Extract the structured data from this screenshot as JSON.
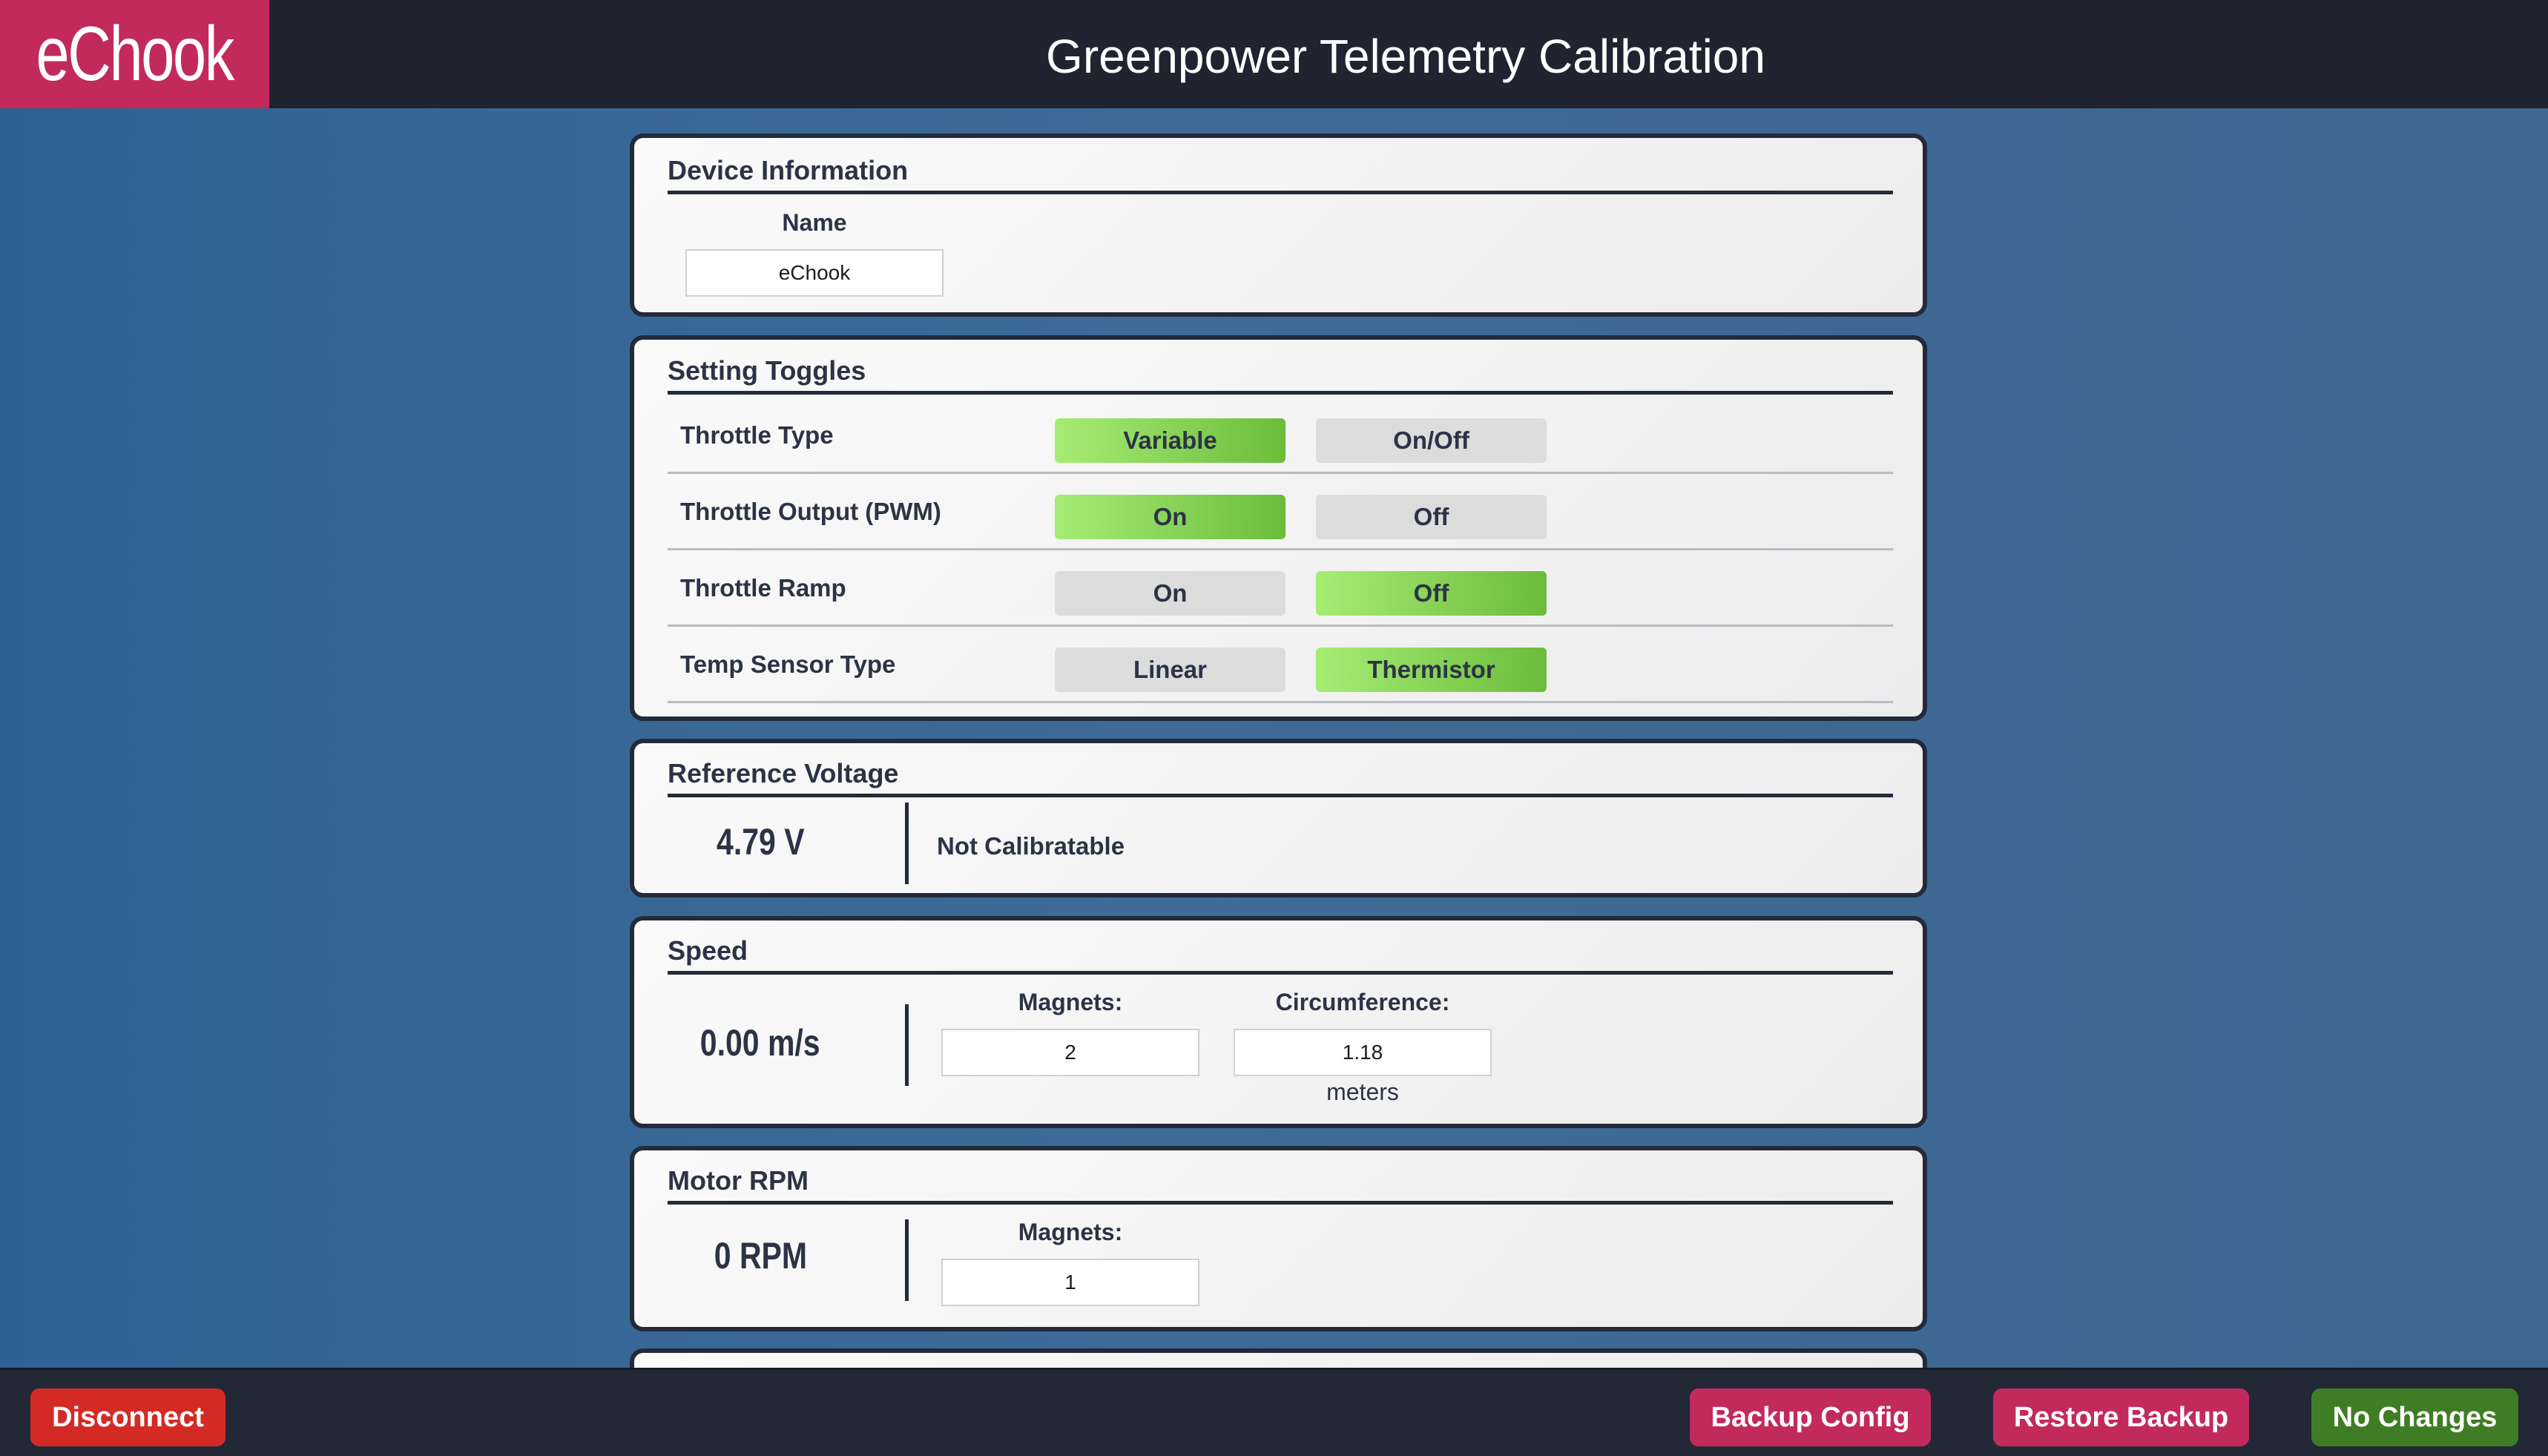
{
  "header": {
    "logo": "eChook",
    "title": "Greenpower Telemetry Calibration"
  },
  "device_info": {
    "title": "Device Information",
    "name_label": "Name",
    "name_value": "eChook"
  },
  "setting_toggles": {
    "title": "Setting Toggles",
    "rows": [
      {
        "label": "Throttle Type",
        "option_a": "Variable",
        "option_b": "On/Off",
        "selected": "Variable"
      },
      {
        "label": "Throttle Output (PWM)",
        "option_a": "On",
        "option_b": "Off",
        "selected": "On"
      },
      {
        "label": "Throttle Ramp",
        "option_a": "On",
        "option_b": "Off",
        "selected": "Off"
      },
      {
        "label": "Temp Sensor Type",
        "option_a": "Linear",
        "option_b": "Thermistor",
        "selected": "Thermistor"
      }
    ]
  },
  "reference_voltage": {
    "title": "Reference Voltage",
    "reading": "4.79 V",
    "note": "Not Calibratable"
  },
  "speed": {
    "title": "Speed",
    "reading": "0.00 m/s",
    "magnets_label": "Magnets:",
    "magnets_value": "2",
    "circumference_label": "Circumference:",
    "circumference_value": "1.18",
    "circumference_unit": "meters"
  },
  "motor_rpm": {
    "title": "Motor RPM",
    "reading": "0 RPM",
    "magnets_label": "Magnets:",
    "magnets_value": "1"
  },
  "footer": {
    "disconnect": "Disconnect",
    "backup": "Backup Config",
    "restore": "Restore Backup",
    "status": "No Changes"
  },
  "colors": {
    "accent": "#c32a5c",
    "header_bg": "#1f2430",
    "active_toggle": "#8bd55a",
    "inactive_toggle": "#dcdcdc",
    "disconnect": "#d42a25",
    "status_ok": "#3f7d24"
  }
}
